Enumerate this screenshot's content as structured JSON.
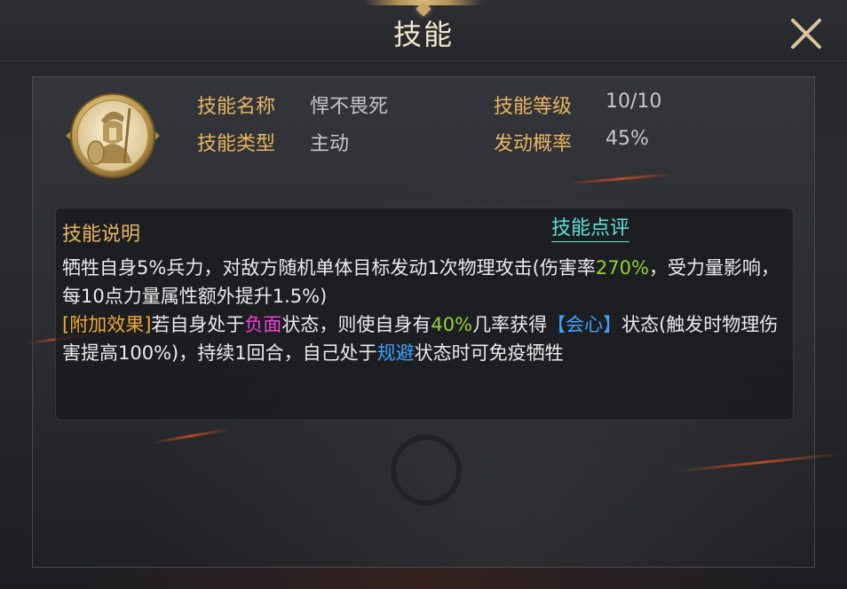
{
  "window": {
    "title": "技能"
  },
  "skill": {
    "name_label": "技能名称",
    "name_value": "悍不畏死",
    "type_label": "技能类型",
    "type_value": "主动",
    "level_label": "技能等级",
    "level_value": "10/10",
    "chance_label": "发动概率",
    "chance_value": "45%",
    "icon": "spartan-warrior-icon"
  },
  "description": {
    "title": "技能说明",
    "review_link": "技能点评",
    "p1_a": "牺牲自身5%兵力，对敌方随机单体目标发动1次物理攻击(伤害率",
    "p1_b": "270%",
    "p1_c": "，受力量影响，每10点力量属性额外提升1.5%)",
    "p2_a": "[附加效果]",
    "p2_b": "若自身处于",
    "p2_c": "负面",
    "p2_d": "状态，则使自身有",
    "p2_e": "40%",
    "p2_f": "几率获得",
    "p2_g": "【会心】",
    "p2_h": "状态(触发时物理伤害提高100%)，持续1回合，自己处于",
    "p2_i": "规避",
    "p2_j": "状态时可免疫牺牲"
  },
  "colors": {
    "label_gold": "#e7b661",
    "value_gray": "#c7c7c7",
    "highlight_green": "#8fd33a",
    "highlight_orange": "#f0a92e",
    "highlight_magenta": "#f043d8",
    "highlight_blue": "#3fa0ff",
    "link_cyan": "#5fe0d6"
  }
}
